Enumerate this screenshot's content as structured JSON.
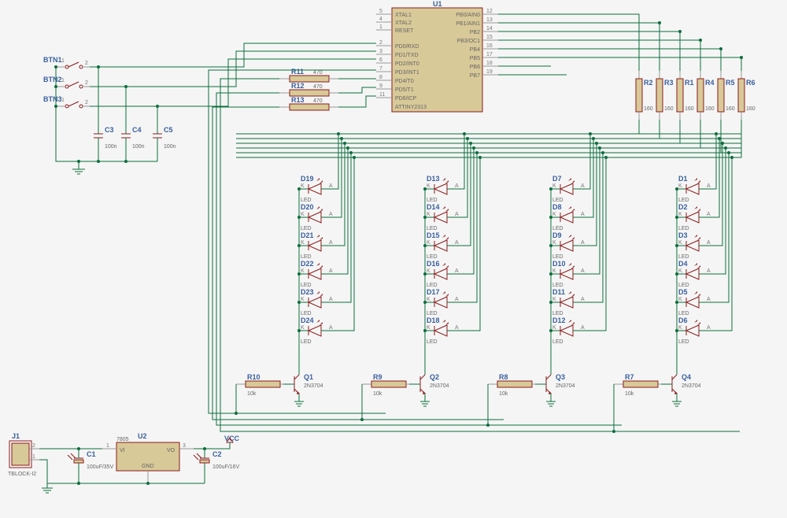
{
  "u1": {
    "ref": "U1",
    "value": "ATTINY2313",
    "pins_left": [
      {
        "num": "5",
        "name": "XTAL1"
      },
      {
        "num": "4",
        "name": "XTAL2"
      },
      {
        "num": "1",
        "name": "RESET"
      },
      {
        "num": "2",
        "name": "PD0/RXD"
      },
      {
        "num": "3",
        "name": "PD1/TXD"
      },
      {
        "num": "6",
        "name": "PD2/INT0"
      },
      {
        "num": "7",
        "name": "PD3/INT1"
      },
      {
        "num": "8",
        "name": "PD4/T0"
      },
      {
        "num": "9",
        "name": "PD5/T1"
      },
      {
        "num": "11",
        "name": "PD6/ICP"
      }
    ],
    "pins_right": [
      {
        "num": "12",
        "name": "PB0/AIN0"
      },
      {
        "num": "13",
        "name": "PB1/AIN1"
      },
      {
        "num": "14",
        "name": "PB2"
      },
      {
        "num": "15",
        "name": "PB3/OC1"
      },
      {
        "num": "16",
        "name": "PB4"
      },
      {
        "num": "17",
        "name": "PB5"
      },
      {
        "num": "18",
        "name": "PB6"
      },
      {
        "num": "19",
        "name": "PB7"
      }
    ]
  },
  "btns": [
    {
      "ref": "BTN1",
      "sub": "1"
    },
    {
      "ref": "BTN2",
      "sub": "1"
    },
    {
      "ref": "BTN3",
      "sub": "1"
    }
  ],
  "caps_in": [
    {
      "ref": "C3",
      "val": "100n"
    },
    {
      "ref": "C4",
      "val": "100n"
    },
    {
      "ref": "C5",
      "val": "100n"
    }
  ],
  "r_in": [
    {
      "ref": "R11",
      "val": "470"
    },
    {
      "ref": "R12",
      "val": "470"
    },
    {
      "ref": "R13",
      "val": "470"
    }
  ],
  "r_pull": [
    {
      "ref": "R2",
      "val": "160"
    },
    {
      "ref": "R3",
      "val": "160"
    },
    {
      "ref": "R1",
      "val": "160"
    },
    {
      "ref": "R4",
      "val": "160"
    },
    {
      "ref": "R5",
      "val": "160"
    },
    {
      "ref": "R6",
      "val": "160"
    }
  ],
  "r_base": [
    {
      "ref": "R10",
      "val": "10k"
    },
    {
      "ref": "R9",
      "val": "10k"
    },
    {
      "ref": "R8",
      "val": "10k"
    },
    {
      "ref": "R7",
      "val": "10k"
    }
  ],
  "transistors": [
    {
      "ref": "Q1",
      "val": "2N3704"
    },
    {
      "ref": "Q2",
      "val": "2N3704"
    },
    {
      "ref": "Q3",
      "val": "2N3704"
    },
    {
      "ref": "Q4",
      "val": "2N3704"
    }
  ],
  "leds": {
    "col1": [
      "D19",
      "D20",
      "D21",
      "D22",
      "D23",
      "D24"
    ],
    "col2": [
      "D13",
      "D14",
      "D15",
      "D16",
      "D17",
      "D18"
    ],
    "col3": [
      "D7",
      "D8",
      "D9",
      "D10",
      "D11",
      "D12"
    ],
    "col4": [
      "D1",
      "D2",
      "D3",
      "D4",
      "D5",
      "D6"
    ],
    "k": "K",
    "a": "A",
    "sub": "LED"
  },
  "u2": {
    "ref": "U2",
    "val": "7805",
    "vi": "VI",
    "vo": "VO",
    "gnd": "GND",
    "pin1": "1",
    "pin3": "3"
  },
  "j1": {
    "ref": "J1",
    "val": "TBLOCK-I2",
    "p1": "1",
    "p2": "2"
  },
  "c1": {
    "ref": "C1",
    "val": "100uF/35V"
  },
  "c2": {
    "ref": "C2",
    "val": "100uF/16V"
  },
  "vcc": "VCC"
}
